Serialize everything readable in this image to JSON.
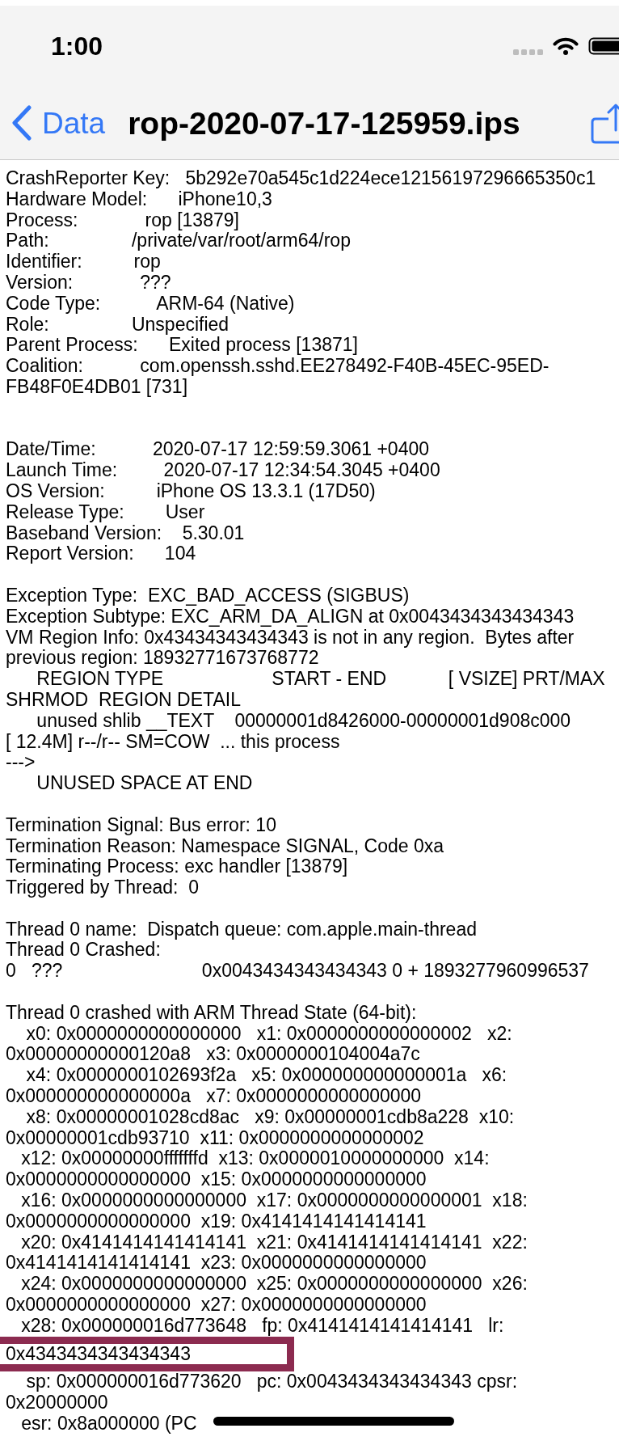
{
  "status_bar": {
    "time": "1:00"
  },
  "nav_bar": {
    "back_label": "Data",
    "title": "rop-2020-07-17-125959.ips"
  },
  "report": [
    {
      "kind": "process",
      "lines": [
        "CrashReporter Key:   5b292e70a545c1d224ece12156197296665350c1",
        "Hardware Model:      iPhone10,3",
        "Process:             rop [13879]",
        "Path:                /private/var/root/arm64/rop",
        "Identifier:          rop",
        "Version:             ???",
        "Code Type:           ARM-64 (Native)",
        "Role:                Unspecified",
        "Parent Process:      Exited process [13871]",
        "Coalition:           com.openssh.sshd.EE278492-F40B-45EC-95ED-",
        "FB48F0E4DB01 [731]"
      ]
    },
    {
      "kind": "dates",
      "lines": [
        "Date/Time:           2020-07-17 12:59:59.3061 +0400",
        "Launch Time:         2020-07-17 12:34:54.3045 +0400",
        "OS Version:          iPhone OS 13.3.1 (17D50)",
        "Release Type:        User",
        "Baseband Version:    5.30.01",
        "Report Version:      104"
      ]
    },
    {
      "kind": "exception",
      "lines": [
        "Exception Type:  EXC_BAD_ACCESS (SIGBUS)",
        "Exception Subtype: EXC_ARM_DA_ALIGN at 0x0043434343434343",
        "VM Region Info: 0x43434343434343 is not in any region.  Bytes after",
        "previous region: 18932771673768772",
        "      REGION TYPE                     START - END            [ VSIZE] PRT/MAX",
        "SHRMOD  REGION DETAIL",
        "      unused shlib __TEXT    00000001d8426000-00000001d908c000",
        "[ 12.4M] r--/r-- SM=COW  ... this process",
        "--->",
        "      UNUSED SPACE AT END"
      ]
    },
    {
      "kind": "termination",
      "lines": [
        "Termination Signal: Bus error: 10",
        "Termination Reason: Namespace SIGNAL, Code 0xa",
        "Terminating Process: exc handler [13879]",
        "Triggered by Thread:  0"
      ]
    },
    {
      "kind": "thread",
      "lines": [
        "Thread 0 name:  Dispatch queue: com.apple.main-thread",
        "Thread 0 Crashed:",
        "0   ???                           0x0043434343434343 0 + 1893277960996537"
      ]
    },
    {
      "kind": "registers",
      "lines": [
        {
          "text": "Thread 0 crashed with ARM Thread State (64-bit):",
          "highlighted": false
        },
        {
          "text": "    x0: 0x0000000000000000   x1: 0x0000000000000002   x2:",
          "highlighted": false
        },
        {
          "text": "0x00000000000120a8   x3: 0x0000000104004a7c",
          "highlighted": false
        },
        {
          "text": "    x4: 0x0000000102693f2a   x5: 0x000000000000001a   x6:",
          "highlighted": false
        },
        {
          "text": "0x000000000000000a   x7: 0x0000000000000000",
          "highlighted": false
        },
        {
          "text": "    x8: 0x00000001028cd8ac   x9: 0x00000001cdb8a228  x10:",
          "highlighted": false
        },
        {
          "text": "0x00000001cdb93710  x11: 0x0000000000000002",
          "highlighted": false
        },
        {
          "text": "   x12: 0x00000000fffffffd  x13: 0x0000010000000000  x14:",
          "highlighted": false
        },
        {
          "text": "0x0000000000000000  x15: 0x0000000000000000",
          "highlighted": false
        },
        {
          "text": "   x16: 0x0000000000000000  x17: 0x0000000000000001  x18:",
          "highlighted": false
        },
        {
          "text": "0x0000000000000000  x19: 0x4141414141414141",
          "highlighted": false
        },
        {
          "text": "   x20: 0x4141414141414141  x21: 0x4141414141414141  x22:",
          "highlighted": false
        },
        {
          "text": "0x4141414141414141  x23: 0x0000000000000000",
          "highlighted": false
        },
        {
          "text": "   x24: 0x0000000000000000  x25: 0x0000000000000000  x26:",
          "highlighted": false
        },
        {
          "text": "0x0000000000000000  x27: 0x0000000000000000",
          "highlighted": false
        },
        {
          "text": "   x28: 0x000000016d773648   fp: 0x4141414141414141   lr:",
          "highlighted": false
        },
        {
          "text": "0x4343434343434343",
          "highlighted": true
        },
        {
          "text": "    sp: 0x000000016d773620   pc: 0x0043434343434343 cpsr:",
          "highlighted": false
        },
        {
          "text": "0x20000000",
          "highlighted": false
        },
        {
          "text": "   esr: 0x8a000000 (PC",
          "highlighted": false
        }
      ]
    }
  ]
}
